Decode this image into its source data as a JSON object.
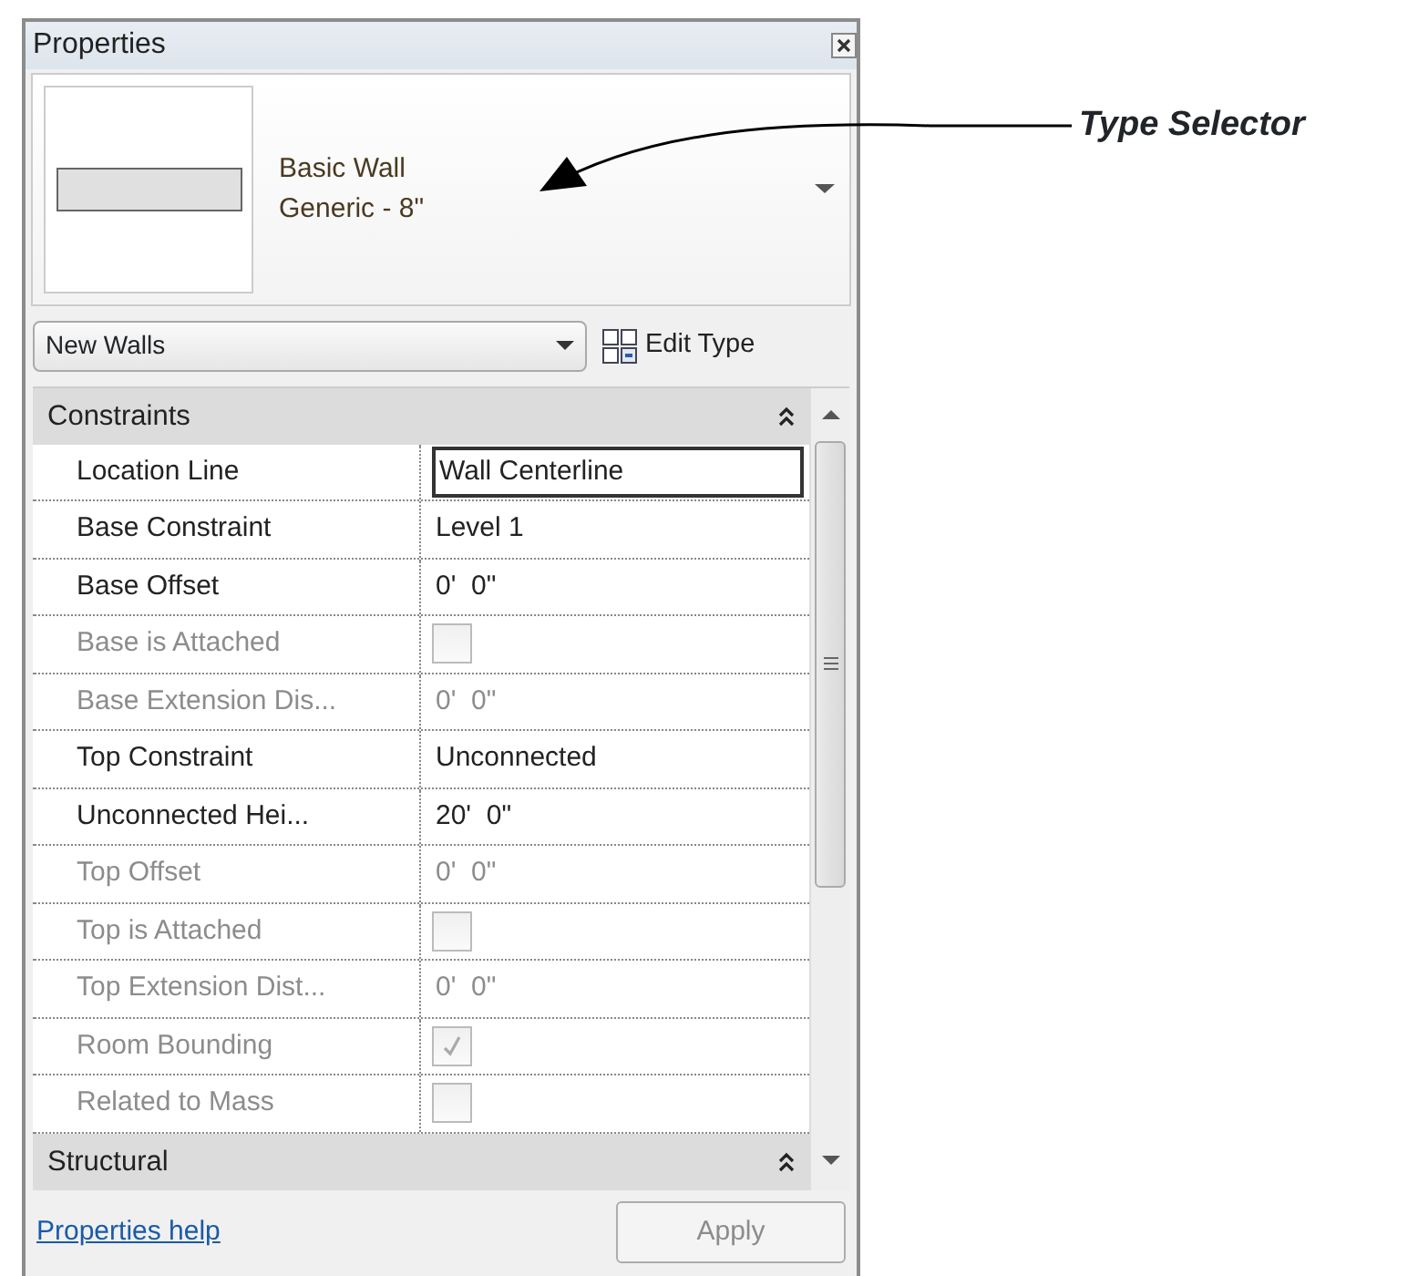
{
  "window": {
    "title": "Properties"
  },
  "type_selector": {
    "family": "Basic Wall",
    "type": "Generic - 8\""
  },
  "instance_filter": {
    "value": "New Walls"
  },
  "edit_type": {
    "label": "Edit Type"
  },
  "groups": [
    {
      "title": "Constraints",
      "expanded": true,
      "rows": [
        {
          "label": "Location Line",
          "kind": "text",
          "value": "Wall Centerline",
          "disabled": false,
          "selected": true
        },
        {
          "label": "Base Constraint",
          "kind": "text",
          "value": "Level 1",
          "disabled": false,
          "selected": false
        },
        {
          "label": "Base Offset",
          "kind": "text",
          "value": "0'  0\"",
          "disabled": false,
          "selected": false
        },
        {
          "label": "Base is Attached",
          "kind": "checkbox",
          "checked": false,
          "disabled": true,
          "selected": false
        },
        {
          "label": "Base Extension Dis...",
          "kind": "text",
          "value": "0'  0\"",
          "disabled": true,
          "selected": false
        },
        {
          "label": "Top Constraint",
          "kind": "text",
          "value": "Unconnected",
          "disabled": false,
          "selected": false
        },
        {
          "label": "Unconnected Hei...",
          "kind": "text",
          "value": "20'  0\"",
          "disabled": false,
          "selected": false
        },
        {
          "label": "Top Offset",
          "kind": "text",
          "value": "0'  0\"",
          "disabled": true,
          "selected": false
        },
        {
          "label": "Top is Attached",
          "kind": "checkbox",
          "checked": false,
          "disabled": true,
          "selected": false
        },
        {
          "label": "Top Extension Dist...",
          "kind": "text",
          "value": "0'  0\"",
          "disabled": true,
          "selected": false
        },
        {
          "label": "Room Bounding",
          "kind": "checkbox",
          "checked": true,
          "disabled": true,
          "selected": false
        },
        {
          "label": "Related to Mass",
          "kind": "checkbox",
          "checked": false,
          "disabled": true,
          "selected": false
        }
      ]
    },
    {
      "title": "Structural",
      "expanded": true
    }
  ],
  "footer": {
    "help_link": "Properties help",
    "apply": {
      "label": "Apply",
      "disabled": true
    }
  },
  "annotation": {
    "label": "Type Selector"
  }
}
